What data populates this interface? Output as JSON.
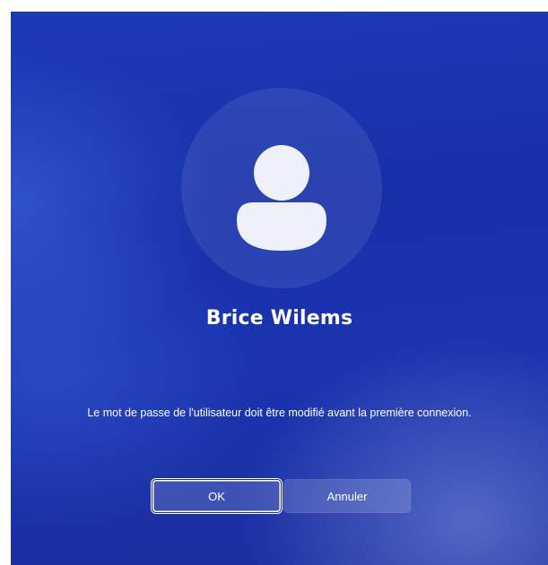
{
  "user": {
    "name": "Brice Wilems"
  },
  "dialog": {
    "message": "Le mot de passe de l'utilisateur doit être modifié avant la première connexion.",
    "ok_label": "OK",
    "cancel_label": "Annuler"
  },
  "icons": {
    "avatar": "user-avatar-icon"
  },
  "colors": {
    "background": "#1a34b0",
    "text": "#ffffff",
    "avatar_glyph": "#eef0fb"
  }
}
